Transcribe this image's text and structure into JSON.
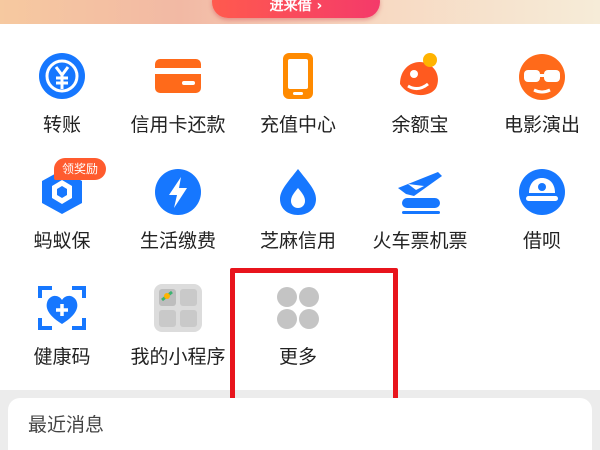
{
  "banner": {
    "button_label": "进来借 ›"
  },
  "grid": {
    "row1": [
      {
        "label": "转账",
        "icon": "transfer-yuan-icon"
      },
      {
        "label": "信用卡还款",
        "icon": "credit-card-icon"
      },
      {
        "label": "充值中心",
        "icon": "phone-topup-icon"
      },
      {
        "label": "余额宝",
        "icon": "yuebao-icon"
      },
      {
        "label": "电影演出",
        "icon": "movie-glasses-icon"
      }
    ],
    "row2": [
      {
        "label": "蚂蚁保",
        "icon": "ant-insurance-icon",
        "badge": "领奖励"
      },
      {
        "label": "生活缴费",
        "icon": "lightning-icon"
      },
      {
        "label": "芝麻信用",
        "icon": "sesame-drop-icon"
      },
      {
        "label": "火车票机票",
        "icon": "plane-train-icon"
      },
      {
        "label": "借呗",
        "icon": "jiebei-icon"
      }
    ],
    "row3": [
      {
        "label": "健康码",
        "icon": "health-code-icon"
      },
      {
        "label": "我的小程序",
        "icon": "mini-program-icon"
      },
      {
        "label": "更多",
        "icon": "more-dots-icon"
      }
    ]
  },
  "recent": {
    "title": "最近消息"
  },
  "colors": {
    "blue": "#1677ff",
    "orange": "#ff6a1a",
    "highlight": "#e8141c"
  }
}
